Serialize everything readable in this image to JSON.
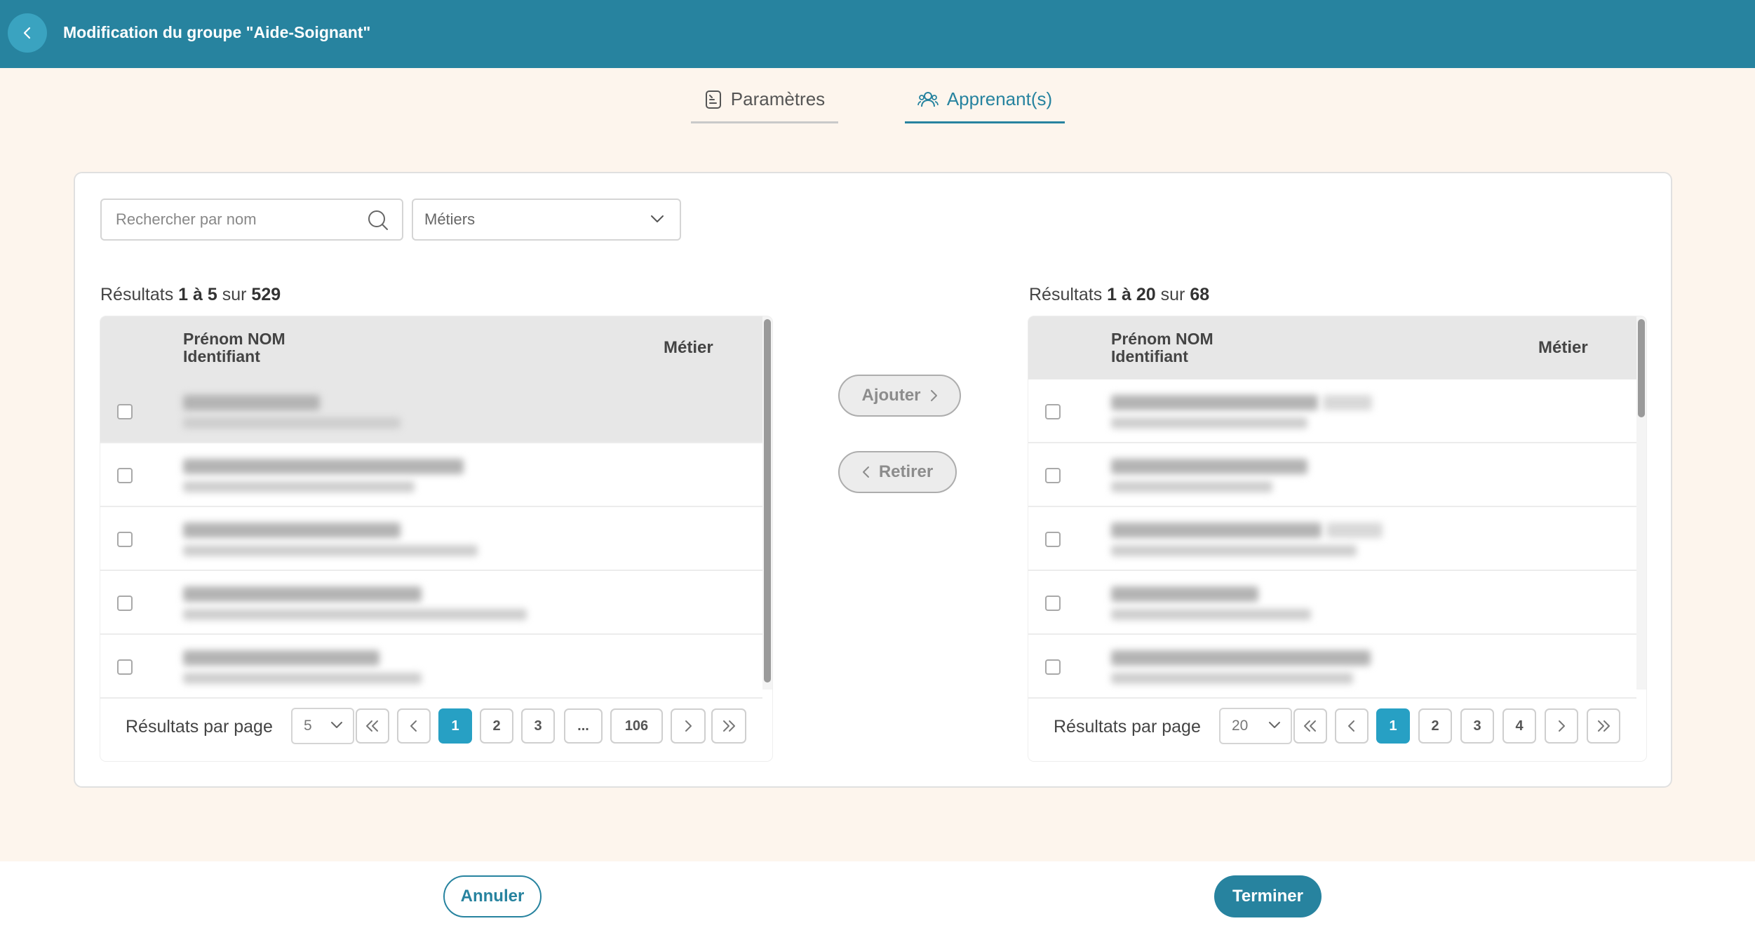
{
  "header": {
    "title": "Modification du groupe \"Aide-Soignant\"",
    "back_icon": "chevron-left-icon"
  },
  "tabs": [
    {
      "label": "Paramètres",
      "icon": "document-icon",
      "active": false
    },
    {
      "label": "Apprenant(s)",
      "icon": "users-icon",
      "active": true
    }
  ],
  "filters": {
    "search_placeholder": "Rechercher par nom",
    "jobs_placeholder": "Métiers"
  },
  "left_list": {
    "results_prefix": "Résultats",
    "range_text": "1 à 5",
    "of_text": "sur",
    "total": "529",
    "header_name_line1": "Prénom NOM",
    "header_name_line2": "Identifiant",
    "header_job": "Métier",
    "rows_count_visible": 5,
    "pagination": {
      "per_page_label": "Résultats par page",
      "per_page_value": "5",
      "pages": [
        "1",
        "2",
        "3",
        "...",
        "106"
      ],
      "current_page": "1"
    }
  },
  "right_list": {
    "results_prefix": "Résultats",
    "range_text": "1 à 20",
    "of_text": "sur",
    "total": "68",
    "header_name_line1": "Prénom NOM",
    "header_name_line2": "Identifiant",
    "header_job": "Métier",
    "rows_count_visible": 5,
    "pagination": {
      "per_page_label": "Résultats par page",
      "per_page_value": "20",
      "pages": [
        "1",
        "2",
        "3",
        "4"
      ],
      "current_page": "1"
    }
  },
  "actions": {
    "add_label": "Ajouter",
    "remove_label": "Retirer"
  },
  "footer": {
    "cancel_label": "Annuler",
    "finish_label": "Terminer"
  },
  "colors": {
    "primary": "#27839f",
    "page_active": "#27a0c4",
    "background": "#fdf5ed"
  }
}
